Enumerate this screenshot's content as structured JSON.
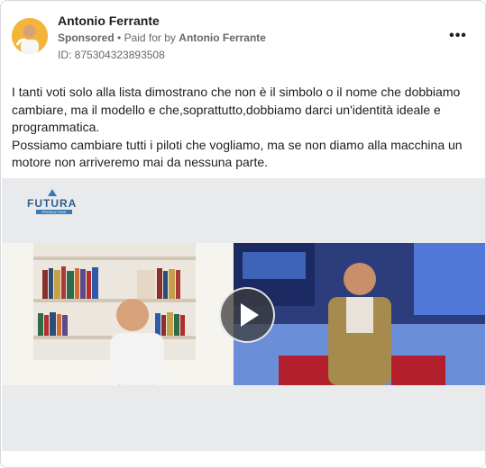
{
  "post": {
    "author": "Antonio Ferrante",
    "sponsored_label": "Sponsored",
    "paid_for_prefix": "Paid for by",
    "paid_for_by": "Antonio Ferrante",
    "ad_id_label": "ID: 875304323893508",
    "body_paragraphs": [
      "I tanti voti solo alla lista dimostrano che non è il simbolo o il nome che dobbiamo cambiare, ma il modello e che,soprattutto,dobbiamo darci un'identità ideale e programmatica.",
      "Possiamo cambiare tutti i piloti che vogliamo, ma se non diamo alla macchina un motore non arriveremo mai da nessuna parte."
    ]
  },
  "video": {
    "logo_text": "FUTURA",
    "logo_subtext": "PRODUCTION"
  },
  "icons": {
    "more": "more-options-icon",
    "play": "play-icon"
  }
}
